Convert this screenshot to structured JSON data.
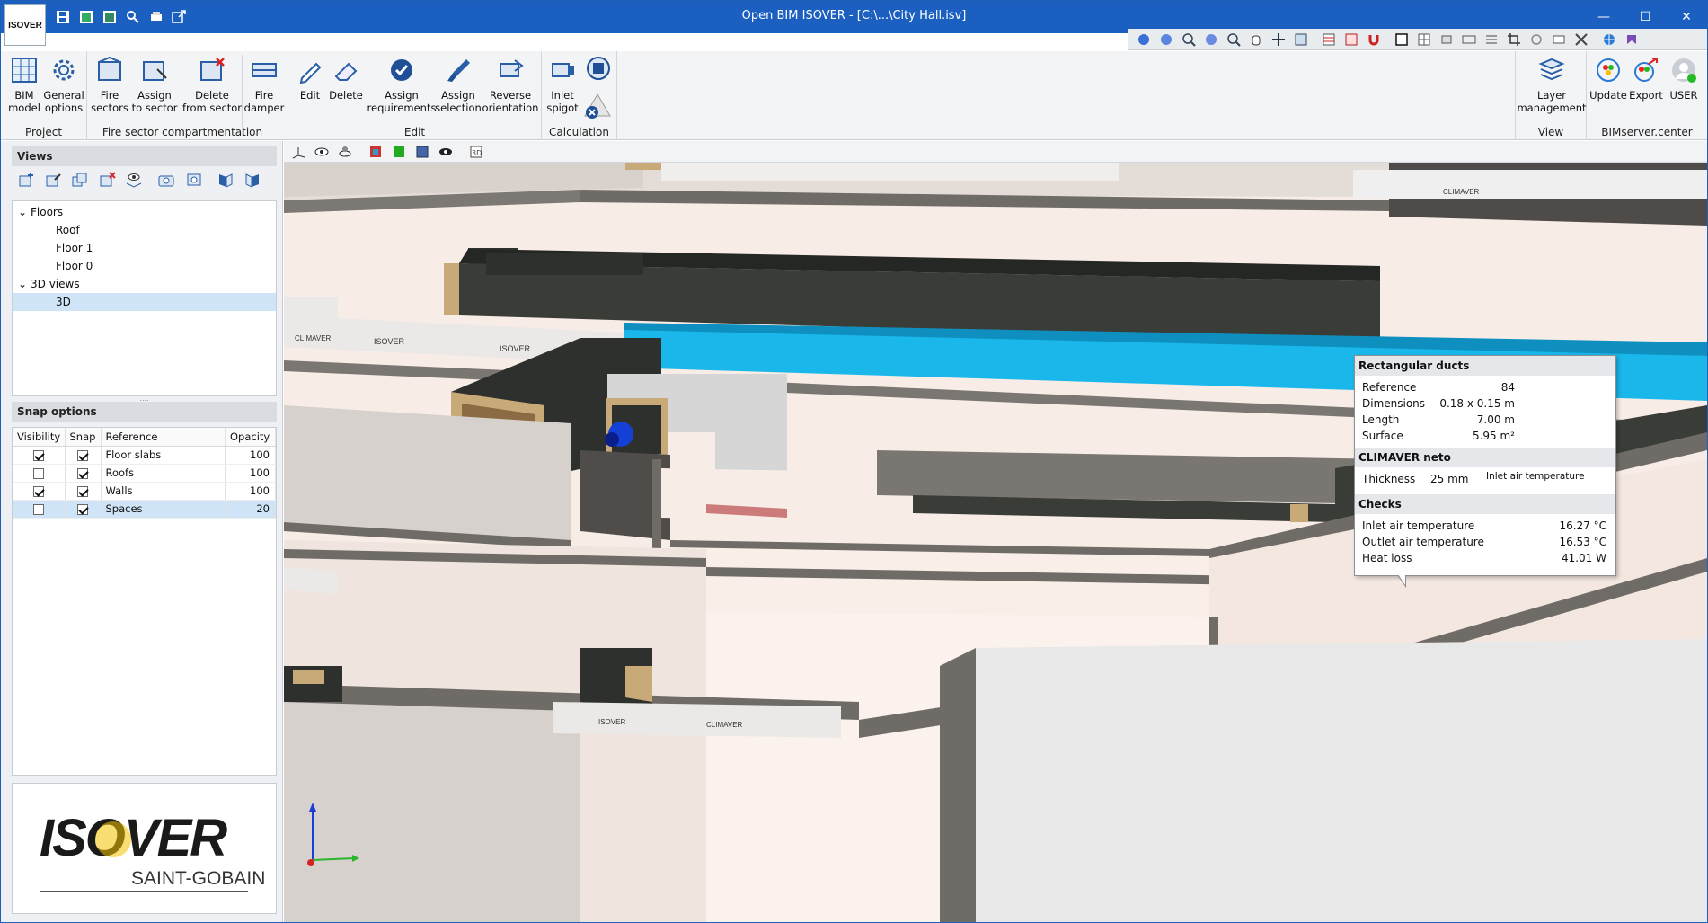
{
  "window": {
    "title": "Open BIM ISOVER - [C:\\...\\City Hall.isv]",
    "logo_text": "ISOVER"
  },
  "quick_access": [
    "save-icon",
    "save-all-icon",
    "save-as-icon",
    "search-icon",
    "print-icon",
    "export-icon"
  ],
  "ribbon": {
    "groups": [
      {
        "label": "Project",
        "buttons": [
          {
            "label": "BIM\nmodel"
          },
          {
            "label": "General\noptions"
          }
        ]
      },
      {
        "label": "Fire sector compartmentation",
        "buttons": [
          {
            "label": "Fire\nsectors"
          },
          {
            "label": "Assign\nto sector"
          },
          {
            "label": "Delete\nfrom sector"
          }
        ]
      },
      {
        "label": "",
        "buttons": [
          {
            "label": "Fire\ndamper"
          }
        ]
      },
      {
        "label": "Edit",
        "buttons": [
          {
            "label": "Edit"
          },
          {
            "label": "Delete"
          },
          {
            "label": "Assign\nrequirements"
          },
          {
            "label": "Assign\nselection"
          },
          {
            "label": "Reverse\norientation"
          }
        ]
      },
      {
        "label": "Calculation",
        "buttons": [
          {
            "label": "Inlet\nspigot"
          }
        ]
      },
      {
        "label": "View",
        "buttons": [
          {
            "label": "Layer\nmanagement"
          }
        ]
      },
      {
        "label": "BIMserver.center",
        "buttons": [
          {
            "label": "Update"
          },
          {
            "label": "Export"
          },
          {
            "label": "USER"
          }
        ]
      }
    ]
  },
  "views_panel": {
    "title": "Views",
    "tree": [
      {
        "label": "Floors",
        "level": 0,
        "expanded": true
      },
      {
        "label": "Roof",
        "level": 1
      },
      {
        "label": "Floor 1",
        "level": 1
      },
      {
        "label": "Floor 0",
        "level": 1
      },
      {
        "label": "3D views",
        "level": 0,
        "expanded": true
      },
      {
        "label": "3D",
        "level": 1,
        "selected": true
      }
    ]
  },
  "snap_panel": {
    "title": "Snap options",
    "columns": [
      "Visibility",
      "Snap",
      "Reference",
      "Opacity"
    ],
    "rows": [
      {
        "visibility": true,
        "snap": true,
        "reference": "Floor slabs",
        "opacity": "100"
      },
      {
        "visibility": false,
        "snap": true,
        "reference": "Roofs",
        "opacity": "100"
      },
      {
        "visibility": true,
        "snap": true,
        "reference": "Walls",
        "opacity": "100"
      },
      {
        "visibility": false,
        "snap": true,
        "reference": "Spaces",
        "opacity": "20",
        "selected": true
      }
    ]
  },
  "brand": {
    "name": "ISOVER",
    "sub": "SAINT-GOBAIN",
    "colors": {
      "yellow": "#f2c200",
      "dark": "#1a1a1a",
      "accent": "#1b5fc1"
    }
  },
  "tooltip": {
    "section1": {
      "title": "Rectangular ducts",
      "rows": [
        {
          "label": "Reference",
          "value": "84"
        },
        {
          "label": "Dimensions",
          "value": "0.18 x 0.15 m"
        },
        {
          "label": "Length",
          "value": "7.00 m"
        },
        {
          "label": "Surface",
          "value": "5.95 m²"
        }
      ]
    },
    "section2": {
      "title": "CLIMAVER neto",
      "thickness_label": "Thickness",
      "thickness_value": "25 mm",
      "note": "Inlet air temperature"
    },
    "section3": {
      "title": "Checks",
      "rows": [
        {
          "label": "Inlet air temperature",
          "value": "16.27 °C"
        },
        {
          "label": "Outlet air temperature",
          "value": "16.53 °C"
        },
        {
          "label": "Heat loss",
          "value": "41.01 W"
        }
      ]
    }
  },
  "scene_labels": {
    "panel_brand": "CLIMAVER",
    "panel_brand2": "ISOVER"
  },
  "colors": {
    "selected_duct": "#19b7ea",
    "duct_dark": "#2e302d",
    "insulation": "#c8a978",
    "wall": "#6f6b67",
    "floor": "#f7ebe4"
  }
}
